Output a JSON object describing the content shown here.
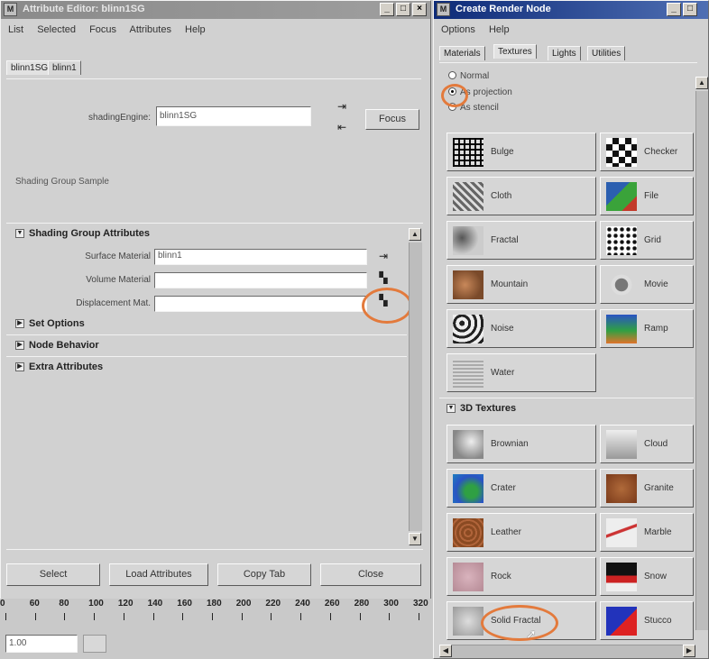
{
  "attr_editor": {
    "title": "Attribute Editor: blinn1SG",
    "menu": [
      "List",
      "Selected",
      "Focus",
      "Attributes",
      "Help"
    ],
    "tabs": [
      "blinn1SG",
      "blinn1"
    ],
    "shading_engine_label": "shadingEngine:",
    "shading_engine_value": "blinn1SG",
    "focus_label": "Focus",
    "sample_label": "Shading Group Sample",
    "sections": {
      "shading_group": "Shading Group Attributes",
      "set_options": "Set Options",
      "node_behavior": "Node Behavior",
      "extra": "Extra Attributes"
    },
    "fields": [
      {
        "label": "Surface Material",
        "value": "blinn1"
      },
      {
        "label": "Volume Material",
        "value": ""
      },
      {
        "label": "Displacement Mat.",
        "value": ""
      }
    ],
    "buttons": [
      "Select",
      "Load Attributes",
      "Copy Tab",
      "Close"
    ]
  },
  "timeline": {
    "ticks": [
      "0",
      "60",
      "80",
      "100",
      "120",
      "140",
      "160",
      "180",
      "200",
      "220",
      "240",
      "260",
      "280",
      "300",
      "320"
    ],
    "current": "1.00"
  },
  "create_render_node": {
    "title": "Create Render Node",
    "menu": [
      "Options",
      "Help"
    ],
    "tabs": [
      "Materials",
      "Textures",
      "Lights",
      "Utilities"
    ],
    "modes": [
      "Normal",
      "As projection",
      "As stencil"
    ],
    "tex2d": [
      "Bulge",
      "Checker",
      "Cloth",
      "File",
      "Fractal",
      "Grid",
      "Mountain",
      "Movie",
      "Noise",
      "Ramp",
      "Water"
    ],
    "tex3d_header": "3D Textures",
    "tex3d": [
      "Brownian",
      "Cloud",
      "Crater",
      "Granite",
      "Leather",
      "Marble",
      "Rock",
      "Snow",
      "Solid Fractal",
      "Stucco"
    ]
  },
  "colors": {
    "highlight": "#e37a3c",
    "active_title": "#0e2b78"
  }
}
